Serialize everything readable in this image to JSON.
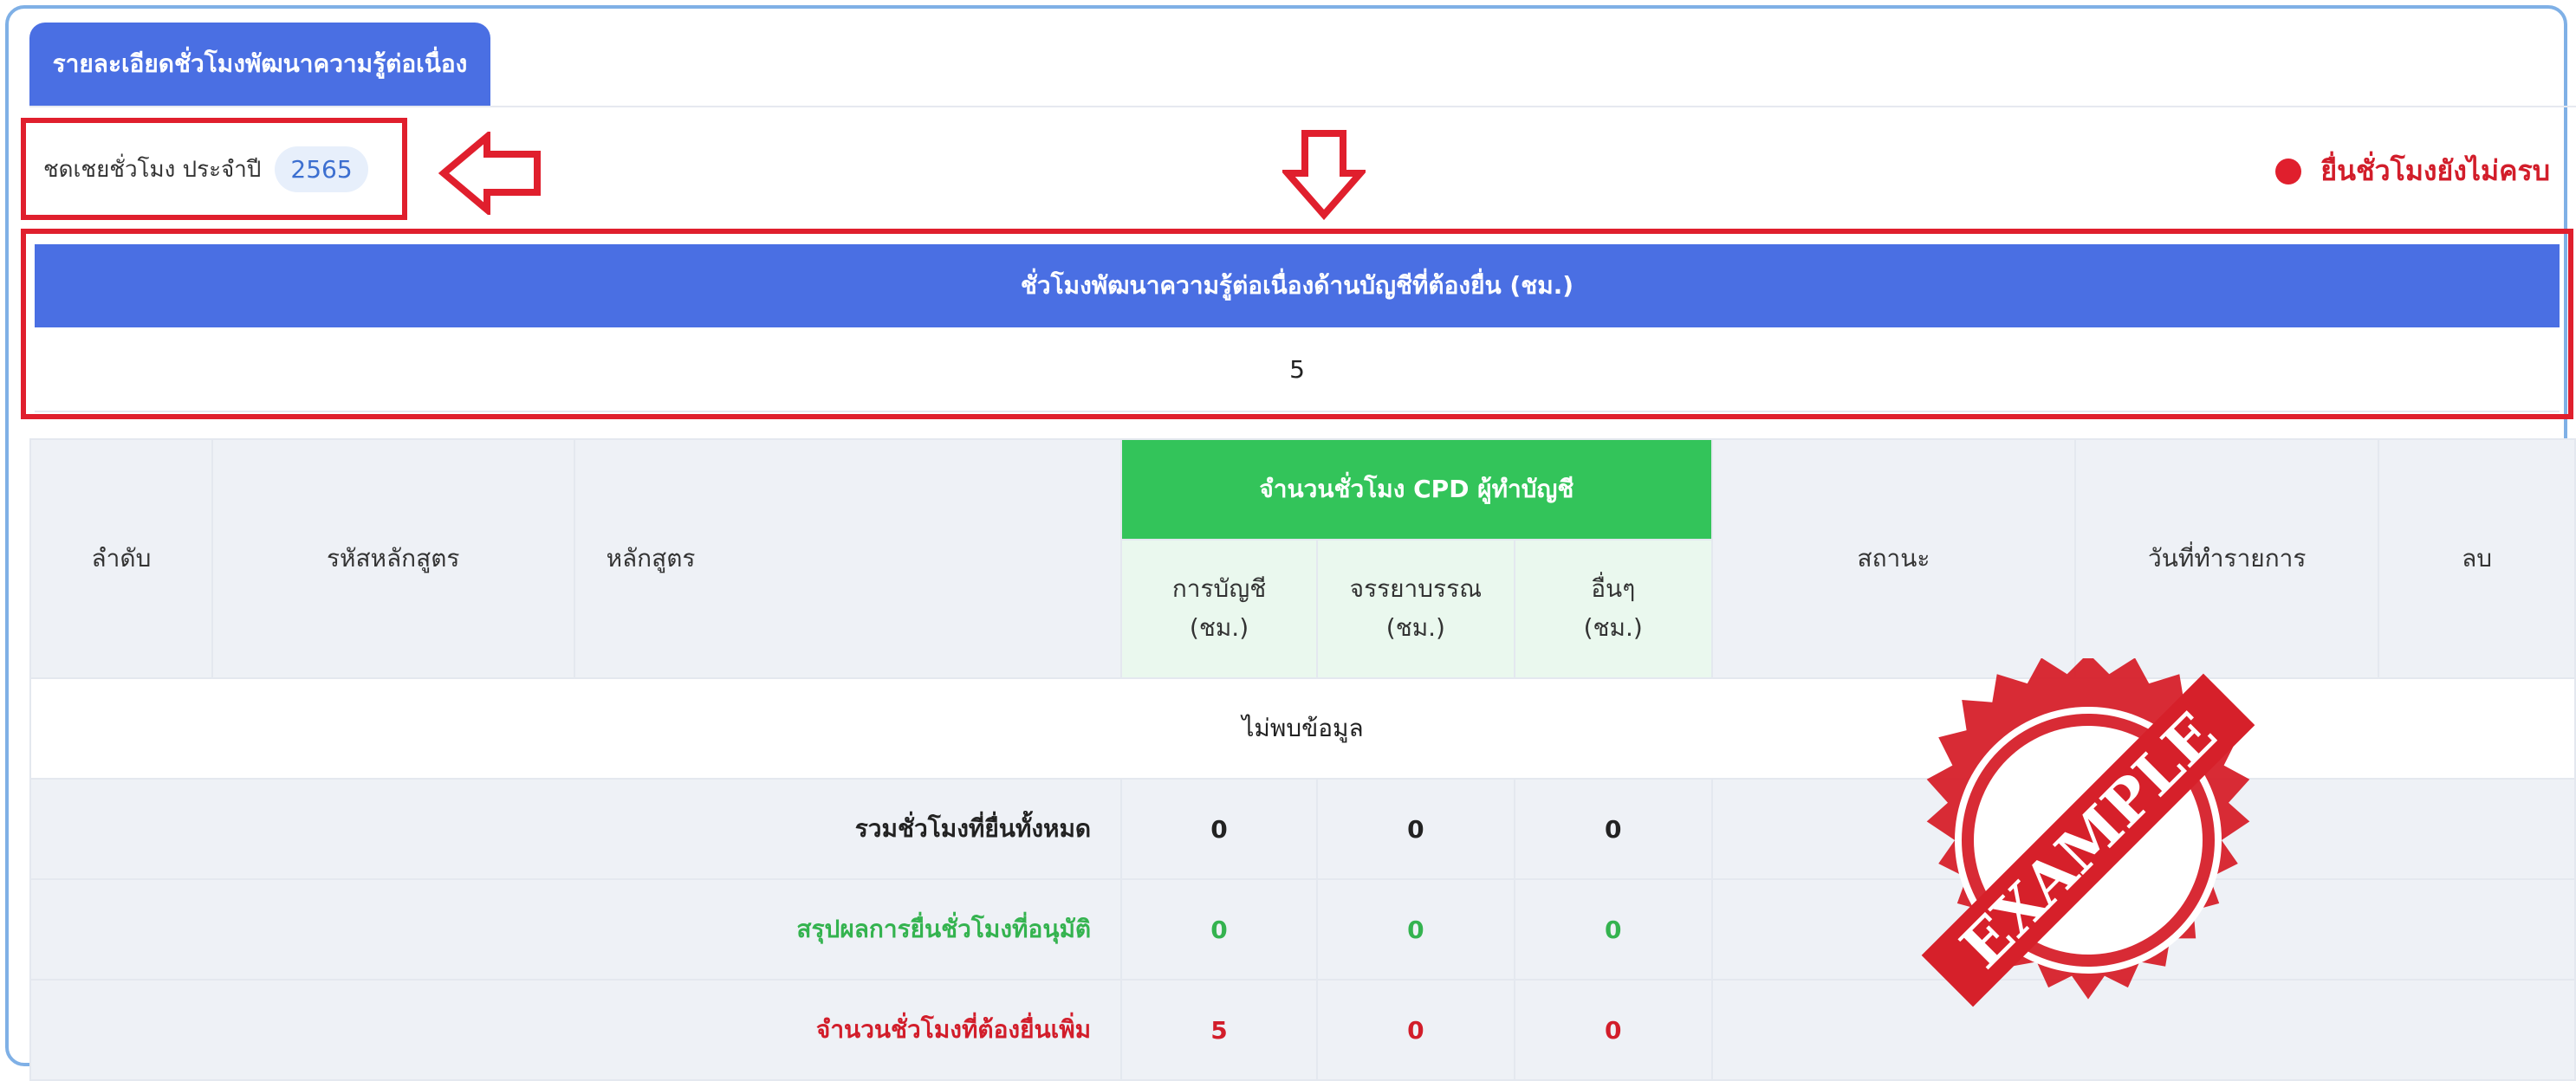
{
  "tab": {
    "label": "รายละเอียดชั่วโมงพัฒนาความรู้ต่อเนื่อง"
  },
  "year": {
    "label": "ชดเชยชั่วโมง ประจำปี",
    "value": "2565"
  },
  "status": {
    "text": "ยื่นชั่วโมงยังไม่ครบ",
    "color": "#e01f2d"
  },
  "required": {
    "title": "ชั่วโมงพัฒนาความรู้ต่อเนื่องด้านบัญชีที่ต้องยื่น (ชม.)",
    "value": "5"
  },
  "table": {
    "headers": {
      "order": "ลำดับ",
      "code": "รหัสหลักสูตร",
      "course": "หลักสูตร",
      "cpd": "จำนวนชั่วโมง CPD ผู้ทำบัญชี",
      "acc_line1": "การบัญชี",
      "acc_line2": "(ชม.)",
      "eth_line1": "จรรยาบรรณ",
      "eth_line2": "(ชม.)",
      "oth_line1": "อื่นๆ",
      "oth_line2": "(ชม.)",
      "status": "สถานะ",
      "date": "วันที่ทำรายการ",
      "delete": "ลบ"
    },
    "empty": "ไม่พบข้อมูล",
    "summary": [
      {
        "label": "รวมชั่วโมงที่ยื่นทั้งหมด",
        "accounting": "0",
        "ethics": "0",
        "other": "0"
      },
      {
        "label": "สรุปผลการยื่นชั่วโมงที่อนุมัติ",
        "accounting": "0",
        "ethics": "0",
        "other": "0"
      },
      {
        "label": "จำนวนชั่วโมงที่ต้องยื่นเพิ่ม",
        "accounting": "5",
        "ethics": "0",
        "other": "0"
      }
    ]
  },
  "stamp": {
    "text": "EXAMPLE"
  },
  "colors": {
    "primary": "#4a6fe3",
    "cpd_green": "#33c45a",
    "alert_red": "#e01f2d"
  }
}
